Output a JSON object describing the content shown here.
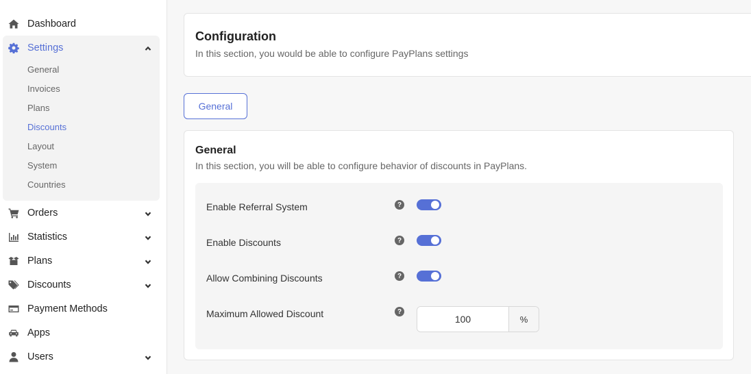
{
  "sidebar": {
    "dashboard": "Dashboard",
    "settings": "Settings",
    "settings_sub": [
      "General",
      "Invoices",
      "Plans",
      "Discounts",
      "Layout",
      "System",
      "Countries"
    ],
    "orders": "Orders",
    "statistics": "Statistics",
    "plans": "Plans",
    "discounts": "Discounts",
    "payment_methods": "Payment Methods",
    "apps": "Apps",
    "users": "Users"
  },
  "config_card": {
    "title": "Configuration",
    "description": "In this section, you would be able to configure PayPlans settings"
  },
  "tab": {
    "label": "General"
  },
  "general_card": {
    "title": "General",
    "description": "In this section, you will be able to configure behavior of discounts in PayPlans.",
    "rows": [
      {
        "label": "Enable Referral System",
        "enabled": true
      },
      {
        "label": "Enable Discounts",
        "enabled": true
      },
      {
        "label": "Allow Combining Discounts",
        "enabled": true
      }
    ],
    "max_discount": {
      "label": "Maximum Allowed Discount",
      "value": "100",
      "suffix": "%"
    },
    "help_glyph": "?"
  },
  "colors": {
    "accent": "#5670d6"
  }
}
